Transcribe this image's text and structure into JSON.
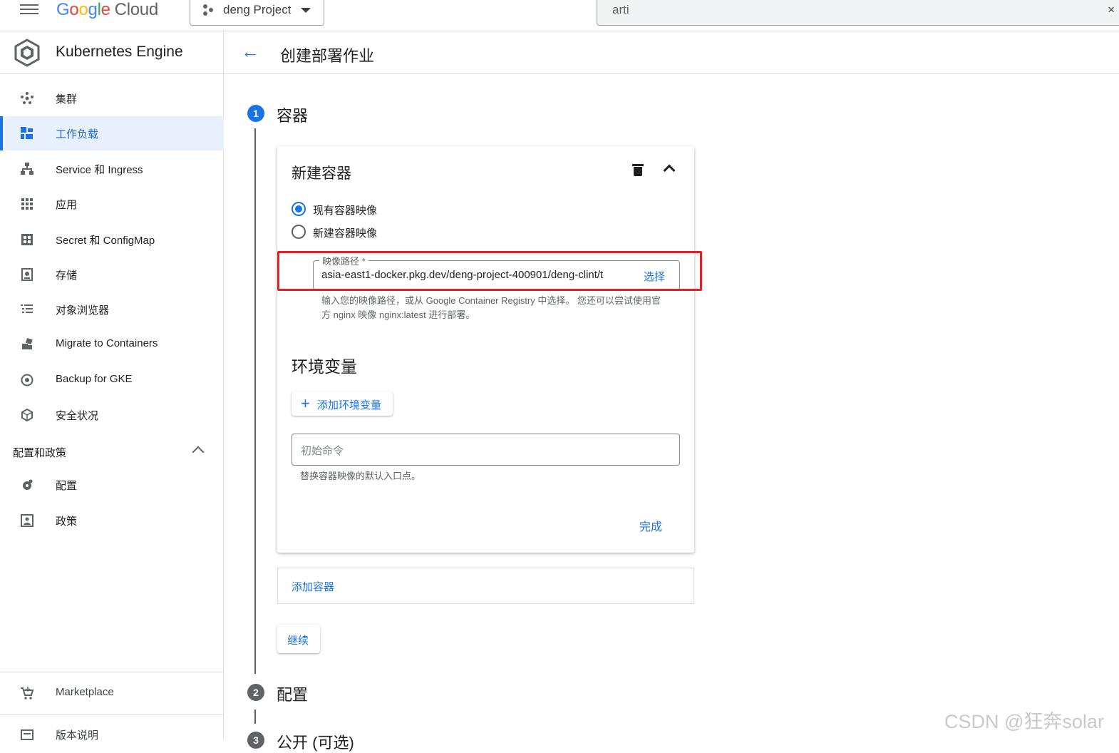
{
  "topbar": {
    "logo_letters": [
      "G",
      "o",
      "o",
      "g",
      "l",
      "e"
    ],
    "logo_cloud": "Cloud",
    "project": "deng Project",
    "search_value": "arti",
    "close_glyph": "×"
  },
  "sidebar": {
    "product": "Kubernetes Engine",
    "items": [
      {
        "label": "集群",
        "icon": "cluster-icon"
      },
      {
        "label": "工作负载",
        "icon": "workloads-icon",
        "active": true
      },
      {
        "label": "Service 和 Ingress",
        "icon": "services-icon"
      },
      {
        "label": "应用",
        "icon": "apps-grid-icon"
      },
      {
        "label": "Secret 和 ConfigMap",
        "icon": "secret-icon"
      },
      {
        "label": "存储",
        "icon": "storage-icon"
      },
      {
        "label": "对象浏览器",
        "icon": "object-browser-icon"
      },
      {
        "label": "Migrate to Containers",
        "icon": "migrate-icon"
      },
      {
        "label": "Backup for GKE",
        "icon": "backup-icon"
      },
      {
        "label": "安全状况",
        "icon": "security-icon"
      }
    ],
    "section": "配置和政策",
    "section_items": [
      {
        "label": "配置",
        "icon": "config-icon"
      },
      {
        "label": "政策",
        "icon": "policy-icon"
      }
    ],
    "bottom_items": [
      {
        "label": "Marketplace",
        "icon": "marketplace-icon"
      },
      {
        "label": "版本说明",
        "icon": "release-notes-icon"
      }
    ]
  },
  "header": {
    "back_glyph": "←",
    "title": "创建部署作业"
  },
  "steps": [
    {
      "number": "1",
      "label": "容器"
    },
    {
      "number": "2",
      "label": "配置"
    },
    {
      "number": "3",
      "label": "公开 (可选)"
    }
  ],
  "container_card": {
    "title": "新建容器",
    "radio_existing": "现有容器映像",
    "radio_new": "新建容器映像",
    "image_path_label": "映像路径 *",
    "image_path_value": "asia-east1-docker.pkg.dev/deng-project-400901/deng-clint/t",
    "select_button": "选择",
    "hint": "输入您的映像路径，或从 Google Container Registry 中选择。 您还可以尝试使用官方 nginx 映像 nginx:latest 进行部署。",
    "env_title": "环境变量",
    "add_env_button": "添加环境变量",
    "add_env_glyph": "+",
    "init_cmd_placeholder": "初始命令",
    "init_cmd_hint": "替换容器映像的默认入口点。",
    "done_button": "完成"
  },
  "add_container": "添加容器",
  "continue_button": "继续",
  "watermark": "CSDN @狂奔solar",
  "colors": {
    "accent": "#1a73e8",
    "highlight_box": "#ea1c24"
  }
}
